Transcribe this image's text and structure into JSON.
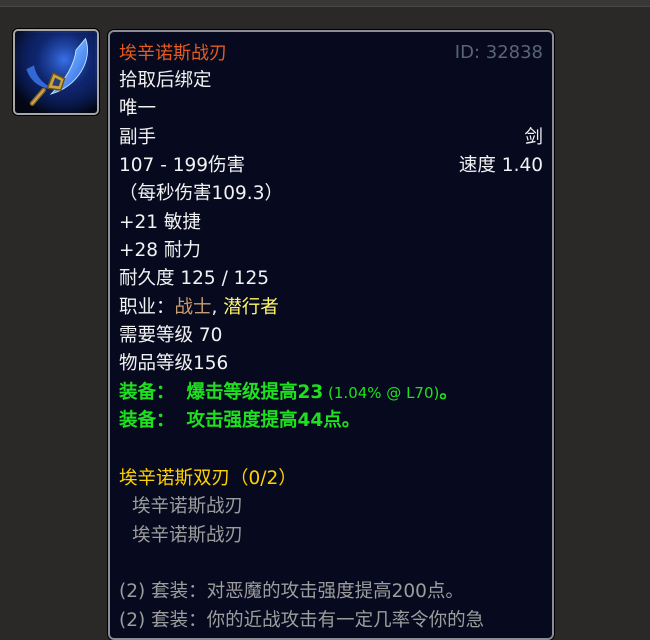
{
  "item": {
    "name": "埃辛诺斯战刃",
    "id_text": "ID: 32838",
    "binding": "拾取后绑定",
    "unique": "唯一",
    "slot": "副手",
    "weapon_type": "剑",
    "damage": "107 - 199伤害",
    "speed": "速度 1.40",
    "dps": "（每秒伤害109.3）",
    "stats": [
      "+21 敏捷",
      "+28 耐力"
    ],
    "durability": "耐久度 125 / 125",
    "classes": {
      "label": "职业：",
      "warrior": "战士",
      "separator": ", ",
      "rogue": "潜行者"
    },
    "required_level": "需要等级 70",
    "item_level": "物品等级156",
    "equip_effects": [
      {
        "label": "装备：",
        "text": "爆击等级提高23",
        "detail": " (1.04% @ L70)",
        "suffix": "。"
      },
      {
        "label": "装备：",
        "text": "攻击强度提高44点。",
        "detail": "",
        "suffix": ""
      }
    ],
    "set": {
      "title": "埃辛诺斯双刃（0/2）",
      "pieces": [
        "埃辛诺斯战刃",
        "埃辛诺斯战刃"
      ],
      "bonuses": [
        "(2) 套装：对恶魔的攻击强度提高200点。",
        "(2) 套装：你的近战攻击有一定几率令你的急"
      ]
    }
  },
  "colors": {
    "item_name": "#e65a1e",
    "equip_green": "#1ee01e",
    "set_title": "#ffd100",
    "set_grey": "#9d9d9d",
    "warrior": "#c79c6e",
    "rogue": "#fff569"
  },
  "icon": {
    "name": "glaive-icon"
  }
}
